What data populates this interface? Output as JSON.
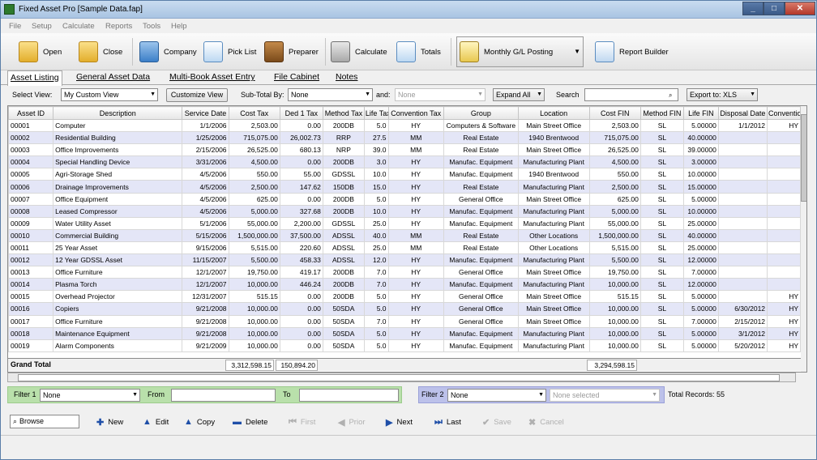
{
  "window": {
    "title": "Fixed Asset Pro [Sample Data.fap]"
  },
  "menu": [
    "File",
    "Setup",
    "Calculate",
    "Reports",
    "Tools",
    "Help"
  ],
  "toolbar": {
    "open": "Open",
    "close": "Close",
    "company": "Company",
    "picklist": "Pick List",
    "preparer": "Preparer",
    "calculate": "Calculate",
    "totals": "Totals",
    "monthly": "Monthly G/L Posting",
    "report_builder": "Report Builder"
  },
  "tabs": [
    "Asset Listing",
    "General Asset Data",
    "Multi-Book Asset Entry",
    "File Cabinet",
    "Notes"
  ],
  "viewbar": {
    "select_view_label": "Select View:",
    "select_view_value": "My Custom View",
    "customize_label": "Customize View",
    "subtotal_label": "Sub-Total By:",
    "subtotal_value": "None",
    "and_label": "and:",
    "and_value": "None",
    "expand_label": "Expand All",
    "search_label": "Search",
    "search_value": "",
    "export_label": "Export to: XLS"
  },
  "columns": [
    "Asset ID",
    "Description",
    "Service Date",
    "Cost Tax",
    "Ded 1 Tax",
    "Method Tax",
    "Life Tax",
    "Convention Tax",
    "Group",
    "Location",
    "Cost FIN",
    "Method FIN",
    "Life FIN",
    "Disposal Date",
    "Conventio"
  ],
  "rows": [
    [
      "00001",
      "Computer",
      "1/1/2006",
      "2,503.00",
      "0.00",
      "200DB",
      "5.0",
      "HY",
      "Computers & Software",
      "Main Street Office",
      "2,503.00",
      "SL",
      "5.00000",
      "1/1/2012",
      "HY"
    ],
    [
      "00002",
      "Residential Building",
      "1/25/2006",
      "715,075.00",
      "26,002.73",
      "RRP",
      "27.5",
      "MM",
      "Real Estate",
      "1940 Brentwood",
      "715,075.00",
      "SL",
      "40.00000",
      "",
      ""
    ],
    [
      "00003",
      "Office Improvements",
      "2/15/2006",
      "26,525.00",
      "680.13",
      "NRP",
      "39.0",
      "MM",
      "Real Estate",
      "Main Street Office",
      "26,525.00",
      "SL",
      "39.00000",
      "",
      ""
    ],
    [
      "00004",
      "Special Handling Device",
      "3/31/2006",
      "4,500.00",
      "0.00",
      "200DB",
      "3.0",
      "HY",
      "Manufac. Equipment",
      "Manufacturing Plant",
      "4,500.00",
      "SL",
      "3.00000",
      "",
      ""
    ],
    [
      "00005",
      "Agri-Storage Shed",
      "4/5/2006",
      "550.00",
      "55.00",
      "GDSSL",
      "10.0",
      "HY",
      "Manufac. Equipment",
      "1940 Brentwood",
      "550.00",
      "SL",
      "10.00000",
      "",
      ""
    ],
    [
      "00006",
      "Drainage Improvements",
      "4/5/2006",
      "2,500.00",
      "147.62",
      "150DB",
      "15.0",
      "HY",
      "Real Estate",
      "Manufacturing Plant",
      "2,500.00",
      "SL",
      "15.00000",
      "",
      ""
    ],
    [
      "00007",
      "Office Equipment",
      "4/5/2006",
      "625.00",
      "0.00",
      "200DB",
      "5.0",
      "HY",
      "General Office",
      "Main Street Office",
      "625.00",
      "SL",
      "5.00000",
      "",
      ""
    ],
    [
      "00008",
      "Leased Compressor",
      "4/5/2006",
      "5,000.00",
      "327.68",
      "200DB",
      "10.0",
      "HY",
      "Manufac. Equipment",
      "Manufacturing Plant",
      "5,000.00",
      "SL",
      "10.00000",
      "",
      ""
    ],
    [
      "00009",
      "Water Utility Asset",
      "5/1/2006",
      "55,000.00",
      "2,200.00",
      "GDSSL",
      "25.0",
      "HY",
      "Manufac. Equipment",
      "Manufacturing Plant",
      "55,000.00",
      "SL",
      "25.00000",
      "",
      ""
    ],
    [
      "00010",
      "Commercial Building",
      "5/15/2006",
      "1,500,000.00",
      "37,500.00",
      "ADSSL",
      "40.0",
      "MM",
      "Real Estate",
      "Other Locations",
      "1,500,000.00",
      "SL",
      "40.00000",
      "",
      ""
    ],
    [
      "00011",
      "25 Year Asset",
      "9/15/2006",
      "5,515.00",
      "220.60",
      "ADSSL",
      "25.0",
      "MM",
      "Real Estate",
      "Other Locations",
      "5,515.00",
      "SL",
      "25.00000",
      "",
      ""
    ],
    [
      "00012",
      "12 Year GDSSL Asset",
      "11/15/2007",
      "5,500.00",
      "458.33",
      "ADSSL",
      "12.0",
      "HY",
      "Manufac. Equipment",
      "Manufacturing Plant",
      "5,500.00",
      "SL",
      "12.00000",
      "",
      ""
    ],
    [
      "00013",
      "Office Furniture",
      "12/1/2007",
      "19,750.00",
      "419.17",
      "200DB",
      "7.0",
      "HY",
      "General Office",
      "Main Street Office",
      "19,750.00",
      "SL",
      "7.00000",
      "",
      ""
    ],
    [
      "00014",
      "Plasma Torch",
      "12/1/2007",
      "10,000.00",
      "446.24",
      "200DB",
      "7.0",
      "HY",
      "Manufac. Equipment",
      "Manufacturing Plant",
      "10,000.00",
      "SL",
      "12.00000",
      "",
      ""
    ],
    [
      "00015",
      "Overhead Projector",
      "12/31/2007",
      "515.15",
      "0.00",
      "200DB",
      "5.0",
      "HY",
      "General Office",
      "Main Street Office",
      "515.15",
      "SL",
      "5.00000",
      "",
      "HY"
    ],
    [
      "00016",
      "Copiers",
      "9/21/2008",
      "10,000.00",
      "0.00",
      "50SDA",
      "5.0",
      "HY",
      "General Office",
      "Main Street Office",
      "10,000.00",
      "SL",
      "5.00000",
      "6/30/2012",
      "HY"
    ],
    [
      "00017",
      "Office Furniture",
      "9/21/2008",
      "10,000.00",
      "0.00",
      "50SDA",
      "7.0",
      "HY",
      "General Office",
      "Main Street Office",
      "10,000.00",
      "SL",
      "7.00000",
      "2/15/2012",
      "HY"
    ],
    [
      "00018",
      "Maintenance Equipment",
      "9/21/2008",
      "10,000.00",
      "0.00",
      "50SDA",
      "5.0",
      "HY",
      "Manufac. Equipment",
      "Manufacturing Plant",
      "10,000.00",
      "SL",
      "5.00000",
      "3/1/2012",
      "HY"
    ],
    [
      "00019",
      "Alarm Components",
      "9/21/2009",
      "10,000.00",
      "0.00",
      "50SDA",
      "5.0",
      "HY",
      "Manufac. Equipment",
      "Manufacturing Plant",
      "10,000.00",
      "SL",
      "5.00000",
      "5/20/2012",
      "HY"
    ]
  ],
  "grand_total": {
    "label": "Grand Total",
    "cost_tax": "3,312,598.15",
    "ded1_tax": "150,894.20",
    "cost_fin": "3,294,598.15"
  },
  "filter1": {
    "label": "Filter 1",
    "value": "None",
    "from_label": "From",
    "to_label": "To"
  },
  "filter2": {
    "label": "Filter 2",
    "value": "None",
    "selected_placeholder": "None selected"
  },
  "total_records": "Total Records: 55",
  "nav": {
    "browse": "Browse",
    "new": "New",
    "edit": "Edit",
    "copy": "Copy",
    "delete": "Delete",
    "first": "First",
    "prior": "Prior",
    "next": "Next",
    "last": "Last",
    "save": "Save",
    "cancel": "Cancel"
  },
  "colors": {
    "row_alt": "#e4e6f7",
    "filter1_bg": "#b9e0ab",
    "filter2_bg": "#bcc1ea"
  }
}
